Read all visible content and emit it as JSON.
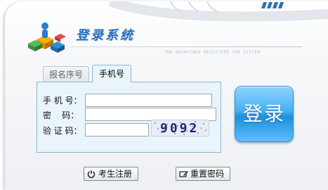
{
  "header": {
    "title": "登录系统",
    "subtitle": "THE BACKSTAGE REGISTERS THE SYSTEM"
  },
  "tabs": [
    {
      "label": "报名序号",
      "active": false
    },
    {
      "label": "手机号",
      "active": true
    }
  ],
  "form": {
    "phone_label": "手 机 号：",
    "phone_value": "",
    "password_label": "密    码：",
    "password_value": "",
    "captcha_label": "验 证 码：",
    "captcha_value": "",
    "captcha_image_text": "9092"
  },
  "buttons": {
    "login": "登录",
    "register": "考生注册",
    "reset_password": "重置密码"
  },
  "colors": {
    "accent": "#2a6fb8",
    "login_button": "#45b0f0",
    "form_background": "#e9f5fa"
  }
}
